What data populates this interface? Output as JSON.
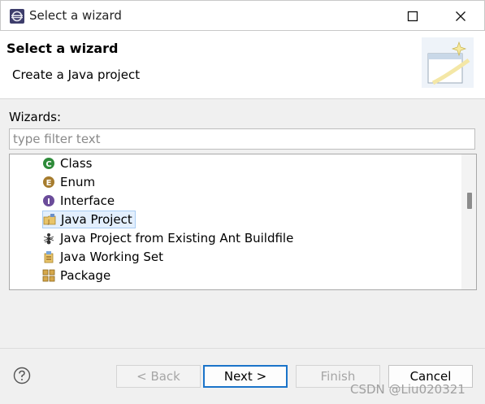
{
  "window": {
    "title": "Select a wizard"
  },
  "header": {
    "title": "Select a wizard",
    "description": "Create a Java project"
  },
  "filter": {
    "label": "Wizards:",
    "placeholder": "type filter text",
    "value": ""
  },
  "tree": {
    "items": [
      {
        "label": "Class",
        "icon": "class-icon"
      },
      {
        "label": "Enum",
        "icon": "enum-icon"
      },
      {
        "label": "Interface",
        "icon": "interface-icon"
      },
      {
        "label": "Java Project",
        "icon": "java-project-icon",
        "selected": true
      },
      {
        "label": "Java Project from Existing Ant Buildfile",
        "icon": "ant-icon"
      },
      {
        "label": "Java Working Set",
        "icon": "working-set-icon"
      },
      {
        "label": "Package",
        "icon": "package-icon"
      }
    ]
  },
  "buttons": {
    "back": "< Back",
    "next": "Next >",
    "finish": "Finish",
    "cancel": "Cancel"
  },
  "watermark": "CSDN @Liu020321",
  "colors": {
    "selection_bg": "#e3effd",
    "selection_border": "#a9cdf4",
    "default_button_border": "#1a73c9"
  }
}
